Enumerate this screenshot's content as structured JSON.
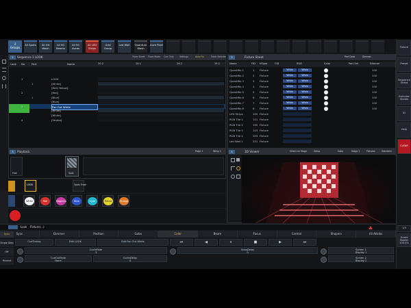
{
  "groups_tag": "Groups",
  "groups_id": "2",
  "group_buttons": [
    {
      "label": "All Spots"
    },
    {
      "label": "All Hit Wash"
    },
    {
      "label": "All 90 Beams"
    },
    {
      "label": "All 90 Auras"
    },
    {
      "label": "All LED Strips"
    },
    {
      "label": "Grid Group"
    },
    {
      "label": "Led Wall"
    },
    {
      "label": "Quantum Wash"
    },
    {
      "label": "Aura Pixel"
    }
  ],
  "right_column": [
    {
      "label": "Fixture"
    },
    {
      "label": "Preset"
    },
    {
      "label": "Sequence Sheet"
    },
    {
      "label": "Executor Sheets"
    },
    {
      "label": "ID"
    },
    {
      "label": "Help"
    },
    {
      "label": "CLEAR"
    },
    {
      "label": "Grand Master",
      "value": "100.0%"
    }
  ],
  "left_side": [
    "Sync",
    "Single Step",
    "Off",
    "Percent"
  ],
  "sequence_sheet": {
    "title": "Sequence 1 LOOK",
    "buttons": [
      "Track Sheet",
      "Track Mode",
      "Cue Only",
      "Settings",
      "Auto Fix",
      "Track Selected"
    ],
    "columns": [
      "Look",
      "No",
      "Part",
      "Name"
    ],
    "channel_headers": [
      "20.2",
      "24.1",
      "24.2",
      "25.1"
    ],
    "rows": [
      {
        "no": "",
        "part": "",
        "name": ""
      },
      {
        "no": "",
        "part": "",
        "name": ""
      },
      {
        "no": "1",
        "part": "",
        "name": "LOOK"
      },
      {
        "no": "",
        "part": "1",
        "name": "[White]"
      },
      {
        "no": "",
        "part": "",
        "name": "[Red/ Yellow]"
      },
      {
        "no": "2",
        "part": "",
        "name": "[Red]"
      },
      {
        "no": "",
        "part": "1",
        "name": "[Blue]"
      },
      {
        "no": "",
        "part": "",
        "name": "[Blue]"
      },
      {
        "no": "3",
        "part": "",
        "name": "Fan Out White"
      },
      {
        "no": "",
        "part": "",
        "name": "[White]"
      },
      {
        "no": "",
        "part": "",
        "name": "[White]"
      },
      {
        "no": "4",
        "part": "",
        "name": "[Strobe]"
      }
    ]
  },
  "fixture_sheet": {
    "title": "Fixture Sheet",
    "buttons": [
      "Part Data",
      "Dimmer",
      "Position",
      "Gobo",
      "Color",
      "Beam",
      "Focus",
      "Control"
    ],
    "columns": [
      "Name",
      "FID",
      "MType",
      "CID",
      "RGB",
      "Color",
      "Part Set",
      "Dimmer"
    ],
    "rows": [
      {
        "name": "QuantWs 1",
        "fid": "1",
        "type": "Fixture",
        "c1": "White",
        "c2": "White",
        "dim": "100"
      },
      {
        "name": "QuantWs 2",
        "fid": "2",
        "type": "Fixture",
        "c1": "White",
        "c2": "White",
        "dim": "100"
      },
      {
        "name": "QuantWs 3",
        "fid": "3",
        "type": "Fixture",
        "c1": "White",
        "c2": "White",
        "dim": "100"
      },
      {
        "name": "QuantWs 4",
        "fid": "4",
        "type": "Fixture",
        "c1": "White",
        "c2": "White",
        "dim": "100"
      },
      {
        "name": "QuantWs 5",
        "fid": "5",
        "type": "Fixture",
        "c1": "White",
        "c2": "White",
        "dim": "100"
      },
      {
        "name": "QuantWs 6",
        "fid": "6",
        "type": "Fixture",
        "c1": "White",
        "c2": "White",
        "dim": "100"
      },
      {
        "name": "QuantWs 7",
        "fid": "7",
        "type": "Fixture",
        "c1": "White",
        "c2": "White",
        "dim": "100"
      },
      {
        "name": "QuantWs 8",
        "fid": "8",
        "type": "Fixture",
        "c1": "White",
        "c2": "White",
        "dim": "100"
      },
      {
        "name": "LED Strips",
        "fid": "100",
        "type": "Fixture",
        "c1": "",
        "c2": "",
        "dim": ""
      },
      {
        "name": "RGB Tile 1",
        "fid": "101",
        "type": "Fixture",
        "c1": "",
        "c2": "",
        "dim": ""
      },
      {
        "name": "RGB Tile 2",
        "fid": "102",
        "type": "Fixture",
        "c1": "",
        "c2": "",
        "dim": ""
      },
      {
        "name": "RGB Tile 3",
        "fid": "103",
        "type": "Fixture",
        "c1": "",
        "c2": "",
        "dim": ""
      },
      {
        "name": "RGB Tile 4",
        "fid": "104",
        "type": "Fixture",
        "c1": "",
        "c2": "",
        "dim": ""
      },
      {
        "name": "Led Wall 1",
        "fid": "201",
        "type": "Fixture",
        "c1": "",
        "c2": "",
        "dim": ""
      }
    ]
  },
  "playback": {
    "title": "Playback",
    "buttons": [
      "Page 1",
      "Wing 1"
    ],
    "items": [
      {
        "label": "Fast"
      },
      {
        "label": "Spot"
      }
    ]
  },
  "look_pool": [
    {
      "label": "LOOK",
      "active": true
    },
    {
      "label": "Spots Fresh",
      "active": false
    }
  ],
  "color_pool": [
    {
      "label": "White",
      "color": "#f2f2f2"
    },
    {
      "label": "Red",
      "color": "#d6322c"
    },
    {
      "label": "Magenta",
      "color": "#c93ca1"
    },
    {
      "label": "Blue",
      "color": "#2d55c8"
    },
    {
      "label": "Cyan",
      "color": "#22b8d0"
    },
    {
      "label": "Yellow",
      "color": "#e3d12c"
    },
    {
      "label": "Orange",
      "color": "#e07a2a"
    }
  ],
  "viewer": {
    "title": "3D Viewer",
    "buttons": [
      "Select on Stage",
      "Setup",
      "Gobo",
      "Stage 1",
      "Fixtures",
      "Standard"
    ]
  },
  "command_line": {
    "prompt": "Look",
    "text": "Fixture(...)"
  },
  "encoder_tabs": [
    {
      "label": "Sync",
      "selected": false
    },
    {
      "label": "Dimmer",
      "selected": false
    },
    {
      "label": "Position",
      "selected": false
    },
    {
      "label": "Gobo",
      "selected": false
    },
    {
      "label": "Color",
      "selected": true
    },
    {
      "label": "Beam",
      "selected": false
    },
    {
      "label": "Focus",
      "selected": false
    },
    {
      "label": "Control",
      "selected": false
    },
    {
      "label": "Shapers",
      "selected": false
    },
    {
      "label": "All Attribs",
      "selected": false
    }
  ],
  "encoder_bar": [
    {
      "label": "CueTiming",
      "value": ""
    },
    {
      "label": "Edit LOOK",
      "value": ""
    },
    {
      "label": "Edit Fan Out White",
      "value": ""
    }
  ],
  "encoders": [
    {
      "label": "CueInFade",
      "value": "3"
    },
    {
      "label": "CueInDelay",
      "value": "0"
    },
    {
      "label": "SnapDelay",
      "value": "0"
    },
    {
      "label": "Screen 1",
      "value": "Display 1"
    },
    {
      "label": "CueOutFade",
      "value": "None"
    },
    {
      "label": "CueOutDelay",
      "value": "None"
    },
    {
      "label": "Screen 2",
      "value": "Display 2"
    }
  ],
  "transport": [
    "skip-back",
    "prev",
    "play",
    "stop",
    "next",
    "skip-forward"
  ]
}
